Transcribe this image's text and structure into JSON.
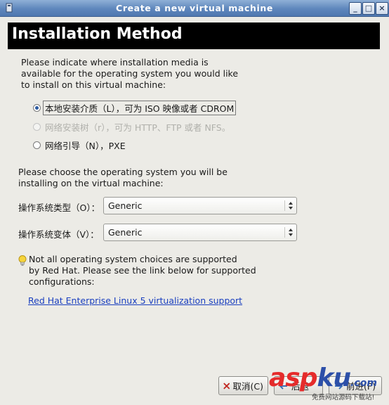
{
  "window": {
    "title": "Create a new virtual machine",
    "buttons": [
      "minimize",
      "maximize",
      "close"
    ]
  },
  "banner": {
    "title": "Installation Method"
  },
  "intro": {
    "lines": [
      "Please indicate where installation media is",
      "available for the operating system you would like",
      "to install on this virtual machine:"
    ]
  },
  "install_options": [
    {
      "label": "本地安装介质（L），可为 ISO 映像或者 CDROM",
      "selected": true,
      "disabled": false
    },
    {
      "label": "网络安装树（r），可为 HTTP、FTP 或者 NFS。",
      "selected": false,
      "disabled": true
    },
    {
      "label": "网络引导（N），PXE",
      "selected": false,
      "disabled": false
    }
  ],
  "os_prompt": {
    "lines": [
      "Please choose the operating system you will be",
      "installing on the virtual machine:"
    ]
  },
  "os_type": {
    "label": "操作系统类型（O）：",
    "value": "Generic"
  },
  "os_variant": {
    "label": "操作系统变体（V）：",
    "value": "Generic"
  },
  "note": {
    "icon": "lightbulb-icon",
    "lines": [
      "Not all operating system choices are supported",
      "by Red Hat. Please see the link below for supported",
      "configurations:"
    ]
  },
  "support_link": {
    "text": "Red Hat Enterprise Linux 5 virtualization support"
  },
  "footer": {
    "cancel_label": "取消(C)",
    "back_label": "后退",
    "forward_label": "前进(F)"
  },
  "watermark": {
    "brand_a": "asp",
    "brand_b": "ku",
    "domain": ".com",
    "sub": "免费网站源码下载站!"
  },
  "colors": {
    "titlebar": "#5e86bc",
    "banner": "#000000",
    "link": "#1a3fbf",
    "watermark_red": "#e52b2b",
    "watermark_blue": "#2c4fa8"
  }
}
